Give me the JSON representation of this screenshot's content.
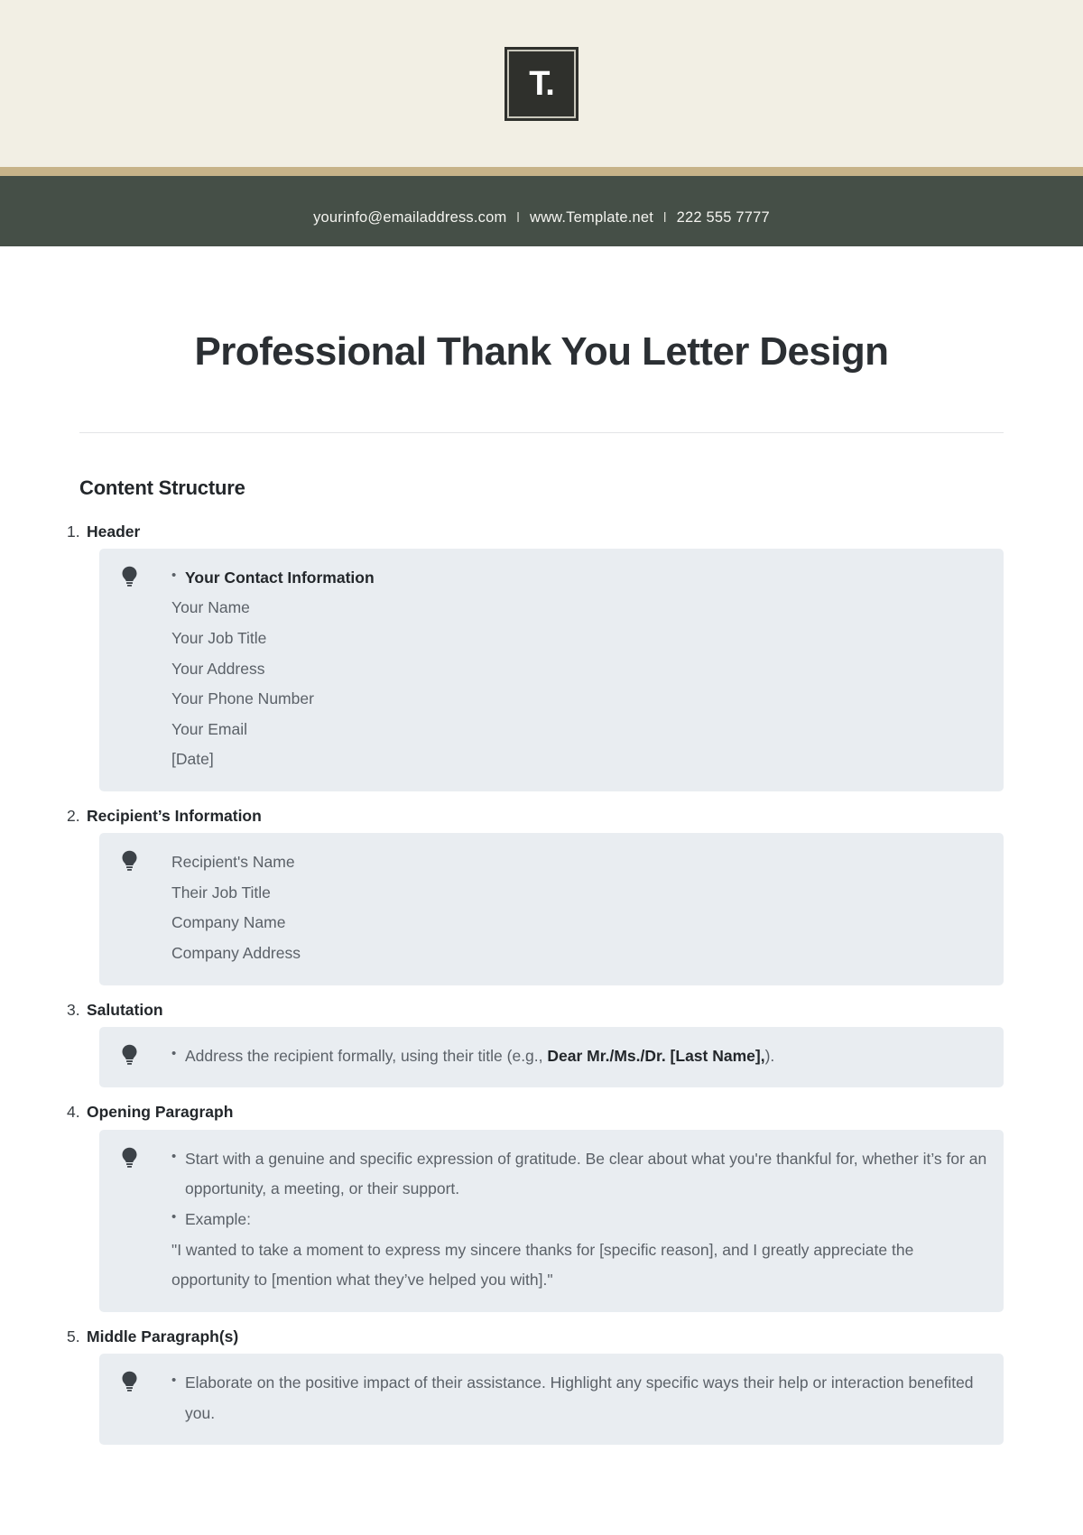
{
  "letterhead": {
    "logo_text": "T.",
    "logo_icon": "template-net-logo-icon",
    "band_color": "#c7b389",
    "bg_color": "#f2efe4",
    "contact_bar_color": "#454f47"
  },
  "contact": {
    "email": "yourinfo@emailaddress.com",
    "separator1": "l",
    "website": "www.Template.net",
    "separator2": "l",
    "phone": "222 555 7777"
  },
  "document": {
    "title": "Professional Thank You Letter Design",
    "section_heading": "Content Structure"
  },
  "sections": [
    {
      "number": "1.",
      "title": "Header",
      "icon": "lightbulb-icon",
      "bullets": [
        {
          "type": "bullet",
          "text": "Your Contact Information",
          "bold": true
        }
      ],
      "plain_lines": [
        "Your Name",
        "Your Job Title",
        "Your Address",
        "Your Phone Number",
        "Your Email",
        "[Date]"
      ]
    },
    {
      "number": "2.",
      "title": "Recipient’s Information",
      "icon": "lightbulb-icon",
      "bullets": [],
      "plain_lines": [
        "Recipient's Name",
        "Their Job Title",
        "Company Name",
        "Company Address"
      ]
    },
    {
      "number": "3.",
      "title": "Salutation",
      "icon": "lightbulb-icon",
      "bullets": [
        {
          "type": "rich",
          "pre": "Address the recipient formally, using their title (e.g., ",
          "bold": "Dear Mr./Ms./Dr. [Last Name],",
          "post": ")."
        }
      ],
      "plain_lines": []
    },
    {
      "number": "4.",
      "title": "Opening Paragraph",
      "icon": "lightbulb-icon",
      "bullets": [
        {
          "type": "bullet",
          "text": "Start with a genuine and specific expression of gratitude. Be clear about what you're thankful for, whether it’s for an opportunity, a meeting, or their support.",
          "bold": false
        },
        {
          "type": "bullet",
          "text": "Example:",
          "bold": false
        }
      ],
      "quote": "\"I wanted to take a moment to express my sincere thanks for [specific reason], and I greatly appreciate the opportunity to [mention what they’ve helped you with].\"",
      "plain_lines": []
    },
    {
      "number": "5.",
      "title": "Middle Paragraph(s)",
      "icon": "lightbulb-icon",
      "bullets": [
        {
          "type": "bullet",
          "text": "Elaborate on the positive impact of their assistance. Highlight any specific ways their help or interaction benefited you.",
          "bold": false
        }
      ],
      "plain_lines": []
    }
  ],
  "colors": {
    "note_box_bg": "#e9edf1",
    "body_text": "#5b6168",
    "heading_text": "#23272b",
    "gold": "#c7b389",
    "green": "#454f47",
    "cream": "#f2efe4"
  }
}
